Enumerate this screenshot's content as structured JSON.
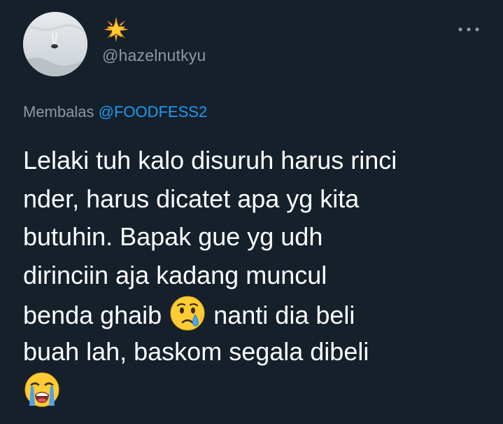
{
  "author": {
    "display_name_icon": "glowing-star-emoji",
    "handle": "@hazelnutkyu",
    "avatar": "profile-photo"
  },
  "header": {
    "more_icon": "more-options-icon"
  },
  "reply": {
    "prefix": "Membalas",
    "mention": "@FOODFESS2"
  },
  "tweet": {
    "line1": "Lelaki tuh kalo disuruh harus rinci",
    "line2": "nder, harus dicatet apa yg kita",
    "line3": "butuhin. Bapak gue yg udh",
    "line4": "dirinciin aja kadang muncul",
    "line5a": "benda ghaib",
    "line5b": "nanti dia beli",
    "line6": "buah lah, baskom segala dibeli",
    "emoji1": "crying-face-emoji",
    "emoji2": "loudly-crying-face-emoji"
  },
  "colors": {
    "background": "#15202b",
    "text": "#ffffff",
    "secondary": "#8b98a5",
    "accent": "#1d9bf0"
  }
}
